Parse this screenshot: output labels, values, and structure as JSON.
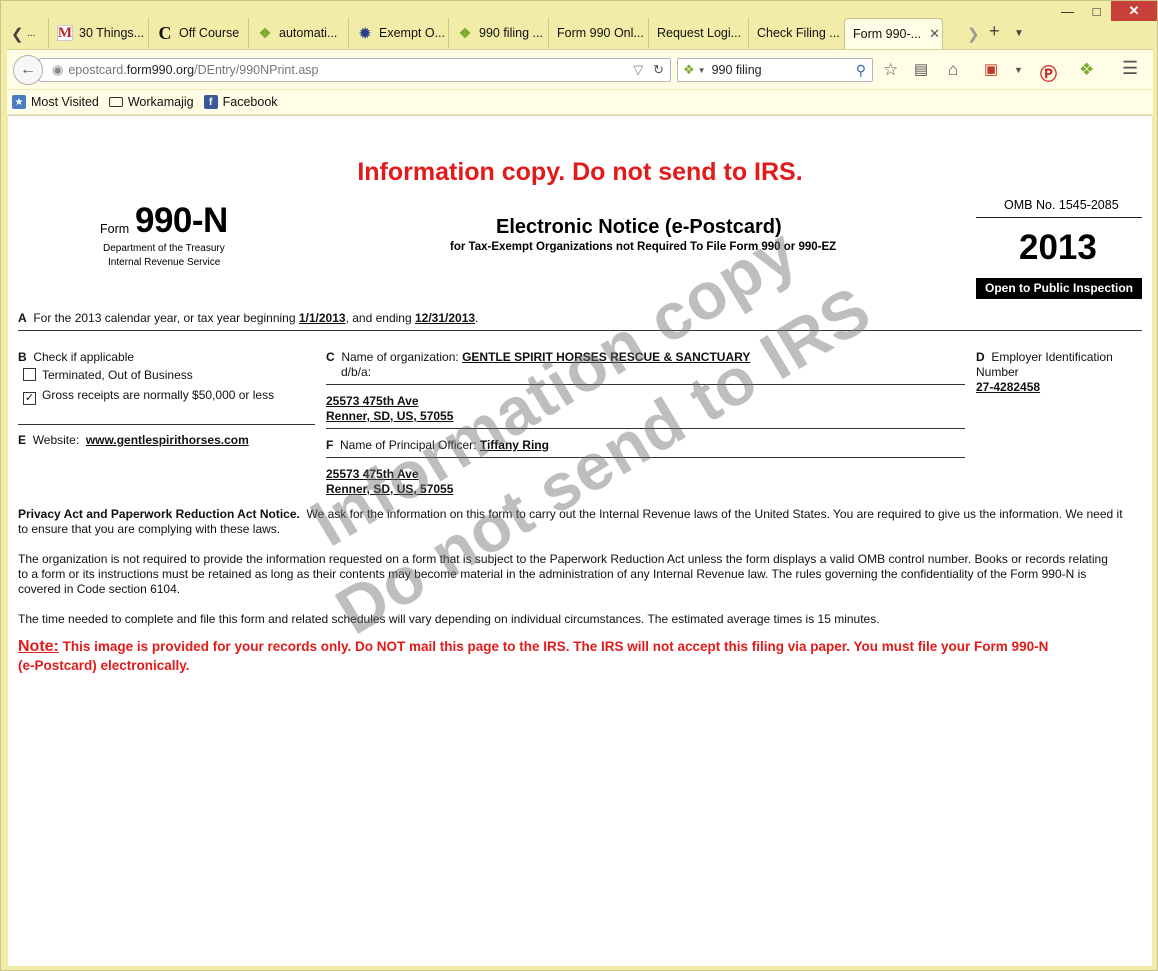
{
  "browser": {
    "tabs": [
      {
        "label": "...",
        "icon": "m-icon"
      },
      {
        "label": "30 Things...",
        "icon": "m-icon"
      },
      {
        "label": "Off Course",
        "icon": "c-icon"
      },
      {
        "label": "automati...",
        "icon": "leaf-icon"
      },
      {
        "label": "Exempt O...",
        "icon": "seal-icon"
      },
      {
        "label": "990 filing ...",
        "icon": "leaf-icon"
      },
      {
        "label": "Form 990 Onl...",
        "icon": ""
      },
      {
        "label": "Request Logi...",
        "icon": ""
      },
      {
        "label": "Check Filing ...",
        "icon": ""
      },
      {
        "label": "Form 990-...",
        "icon": ""
      }
    ],
    "url": {
      "prefix": "epostcard.",
      "domain": "form990.org",
      "path": "/DEntry/990NPrint.asp"
    },
    "search_value": "990 filing",
    "bookmarks": [
      {
        "label": "Most Visited"
      },
      {
        "label": "Workamajig"
      },
      {
        "label": "Facebook"
      }
    ]
  },
  "form": {
    "banner": "Information copy. Do not send to IRS.",
    "form_word": "Form",
    "form_number": "990-N",
    "dept_line1": "Department of the Treasury",
    "dept_line2": "Internal Revenue Service",
    "title": "Electronic Notice (e-Postcard)",
    "subtitle": "for Tax-Exempt Organizations not Required To File Form 990 or 990-EZ",
    "omb": "OMB No. 1545-2085",
    "year": "2013",
    "public_inspection": "Open to Public Inspection",
    "section_a": {
      "letter": "A",
      "text_before": "For the 2013 calendar year, or tax year beginning",
      "begin": "1/1/2013",
      "text_mid": ", and ending",
      "end": "12/31/2013",
      "text_after": "."
    },
    "section_b": {
      "letter": "B",
      "label": "Check if applicable",
      "terminated": "Terminated, Out of Business",
      "gross_receipts": "Gross receipts are normally $50,000 or less"
    },
    "section_c": {
      "letter": "C",
      "label": "Name of organization:",
      "org_name": "GENTLE SPIRIT HORSES RESCUE & SANCTUARY",
      "dba": "d/b/a:",
      "address1": "25573 475th Ave",
      "address2": "Renner, SD, US, 57055"
    },
    "section_d": {
      "letter": "D",
      "label1": "Employer Identification",
      "label2": "Number",
      "ein": "27-4282458"
    },
    "section_e": {
      "letter": "E",
      "label": "Website:",
      "website": "www.gentlespirithorses.com"
    },
    "section_f": {
      "letter": "F",
      "label": "Name of Principal Officer:",
      "officer": "Tiffany Ring",
      "address1": "25573 475th Ave",
      "address2": "Renner, SD, US, 57055"
    },
    "privacy_heading": "Privacy Act and Paperwork Reduction Act Notice.",
    "privacy_p1_line1": "We ask for the information on this form to carry out the Internal Revenue laws of the United States. You are required to give us the information. We need it",
    "privacy_p1_line2": "to ensure that you are complying with these laws.",
    "privacy_p2_line1": "The organization is not required to provide the information requested on a form that is subject to the Paperwork Reduction Act unless the form displays a valid OMB control number. Books or records relating",
    "privacy_p2_line2": "to a form or its instructions must be retained as long as their contents may become material in the administration of any Internal Revenue law. The rules governing the confidentiality of the Form 990-N is",
    "privacy_p2_line3": "covered in Code section 6104.",
    "privacy_p3": "The time needed to complete and file this form and related schedules will vary depending on individual circumstances. The estimated average times is 15 minutes.",
    "note_label": "Note:",
    "note_line1": "This image is provided for your records only. Do NOT mail this page to the IRS. The IRS will not accept this filing via paper. You must file your Form 990-N",
    "note_line2": "(e-Postcard) electronically.",
    "watermark_line1": "Information copy",
    "watermark_line2": "Do not send to IRS"
  }
}
